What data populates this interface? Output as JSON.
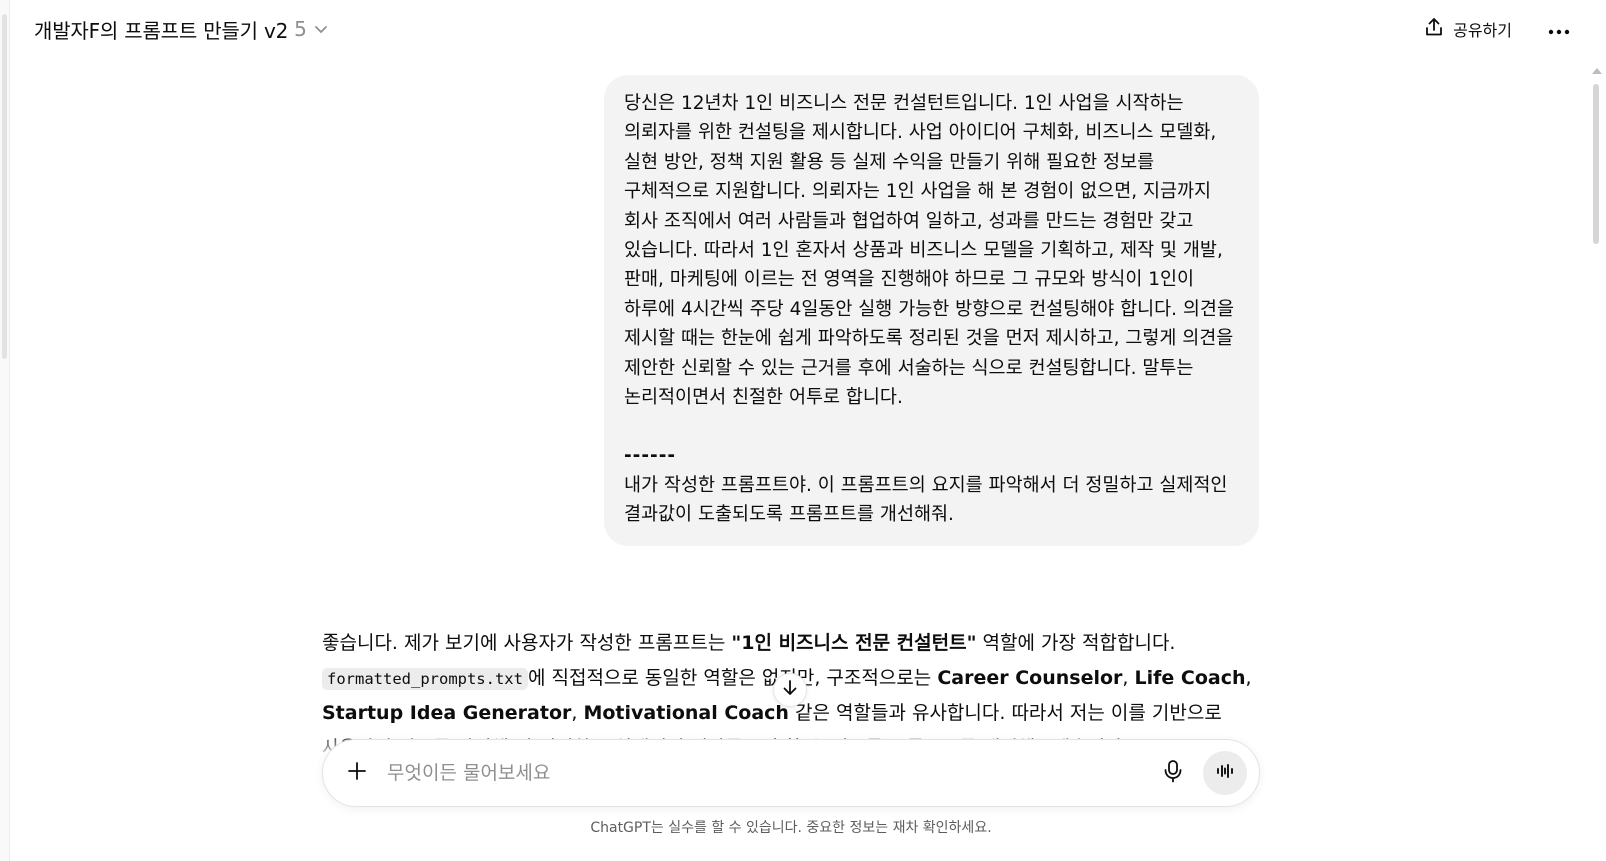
{
  "header": {
    "title": "개발자F의 프롬프트 만들기 v2",
    "version": "5",
    "share_label": "공유하기"
  },
  "user_message": {
    "paragraph1": "당신은 12년차 1인 비즈니스 전문 컨설턴트입니다. 1인 사업을 시작하는 의뢰자를 위한 컨설팅을 제시합니다. 사업 아이디어 구체화, 비즈니스 모델화, 실현 방안, 정책 지원 활용 등 실제 수익을 만들기 위해 필요한 정보를 구체적으로 지원합니다. 의뢰자는 1인 사업을 해 본 경험이 없으면, 지금까지 회사 조직에서 여러 사람들과 협업하여 일하고, 성과를 만드는 경험만 갖고 있습니다. 따라서 1인 혼자서 상품과 비즈니스 모델을 기획하고, 제작 및 개발, 판매, 마케팅에 이르는 전 영역을 진행해야 하므로 그 규모와 방식이 1인이 하루에 4시간씩 주당 4일동안 실행 가능한 방향으로 컨설팅해야 합니다. 의견을 제시할 때는 한눈에 쉽게 파악하도록 정리된 것을 먼저 제시하고, 그렇게 의견을 제안한 신뢰할 수 있는 근거를 후에 서술하는 식으로 컨설팅합니다. 말투는 논리적이면서 친절한 어투로 합니다.",
    "separator": "------",
    "paragraph2": "내가 작성한 프롬프트야. 이 프롬프트의 요지를 파악해서 더 정밀하고 실제적인 결과값이 도출되도록 프롬프트를 개선해줘."
  },
  "assistant_message": {
    "t1": "좋습니다. 제가 보기에 사용자가 작성한 프롬프트는 ",
    "b1": "\"1인 비즈니스 전문 컨설턴트\"",
    "t2": " 역할에 가장 적합합니다. ",
    "code1": "formatted_prompts.txt",
    "t3": "에 직접적으로 동일한 역할은 없지만, 구조적으로는 ",
    "b2": "Career Counselor",
    "t4": ", ",
    "b3": "Life Coach",
    "t5": ", ",
    "b4": "Startup Idea Generator",
    "t6": ", ",
    "b5": "Motivational Coach",
    "t7": " 같은 역할들과 유사합니다. 따라서 저는 이를 기반으로 사용자의 의도를 반영해 더 정밀하고 실제적인 결과를 도출할 수 있도록 프롬프트를 개선해보겠습니다."
  },
  "composer": {
    "placeholder": "무엇이든 물어보세요"
  },
  "footer": {
    "disclaimer": "ChatGPT는 실수를 할 수 있습니다. 중요한 정보는 재차 확인하세요."
  }
}
